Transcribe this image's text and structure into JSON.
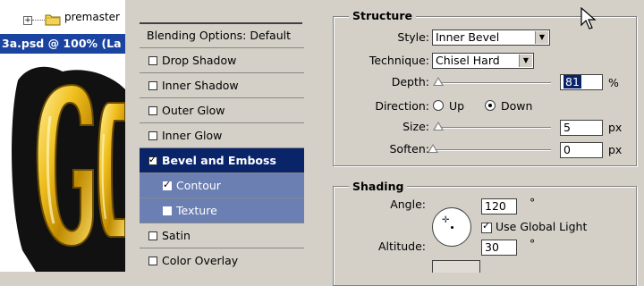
{
  "layers": {
    "group_name": "premaster",
    "document_title": "3a.psd @ 100% (La"
  },
  "canvas": {
    "art_text": "GO"
  },
  "styles": {
    "header": "Blending Options: Default",
    "items": [
      {
        "label": "Drop Shadow",
        "checked": false
      },
      {
        "label": "Inner Shadow",
        "checked": false
      },
      {
        "label": "Outer Glow",
        "checked": false
      },
      {
        "label": "Inner Glow",
        "checked": false
      },
      {
        "label": "Bevel and Emboss",
        "checked": true
      },
      {
        "label": "Contour",
        "checked": true
      },
      {
        "label": "Texture",
        "checked": false
      },
      {
        "label": "Satin",
        "checked": false
      },
      {
        "label": "Color Overlay",
        "checked": false
      }
    ]
  },
  "structure": {
    "title": "Structure",
    "style_label": "Style:",
    "style_value": "Inner Bevel",
    "technique_label": "Technique:",
    "technique_value": "Chisel Hard",
    "depth_label": "Depth:",
    "depth_value": "81",
    "depth_unit": "%",
    "direction_label": "Direction:",
    "direction_up": "Up",
    "direction_down": "Down",
    "direction_selected": "Down",
    "size_label": "Size:",
    "size_value": "5",
    "size_unit": "px",
    "soften_label": "Soften:",
    "soften_value": "0",
    "soften_unit": "px"
  },
  "shading": {
    "title": "Shading",
    "angle_label": "Angle:",
    "angle_value": "120",
    "angle_unit": "°",
    "global_light_label": "Use Global Light",
    "global_light_checked": true,
    "altitude_label": "Altitude:",
    "altitude_value": "30",
    "altitude_unit": "°"
  },
  "colors": {
    "selection": "#0a246a",
    "sub_item": "#6b7fb2",
    "doc_title": "#1a44a0",
    "gold": "#e8b400"
  }
}
